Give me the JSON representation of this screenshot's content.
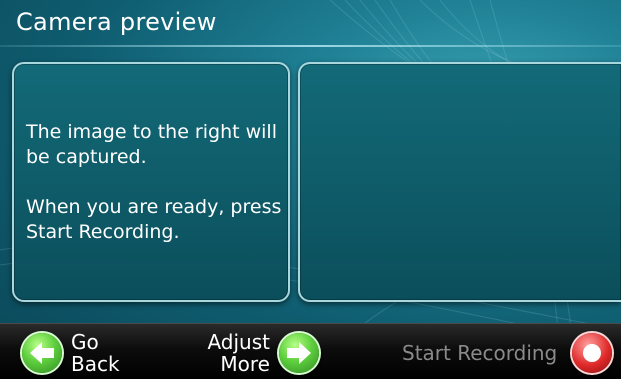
{
  "header": {
    "title": "Camera preview"
  },
  "info_panel": {
    "line1": "The image to the right will be captured.",
    "line2": "When you are ready, press Start Recording."
  },
  "bottom_bar": {
    "go_back": {
      "line1": "Go",
      "line2": "Back"
    },
    "adjust_more": {
      "line1": "Adjust",
      "line2": "More"
    },
    "start_recording": {
      "label": "Start Recording",
      "state": "disabled"
    }
  },
  "icons": {
    "go_back": "left-arrow-icon",
    "adjust_more": "right-arrow-icon",
    "start_recording": "record-icon"
  },
  "colors": {
    "background": "#1f7f94",
    "panel": "#0f5d6c",
    "panel_border": "#a9d7de",
    "nav_green": "#5fcf3e",
    "record_red": "#e02a2a",
    "disabled_text": "#8a8a8a"
  }
}
